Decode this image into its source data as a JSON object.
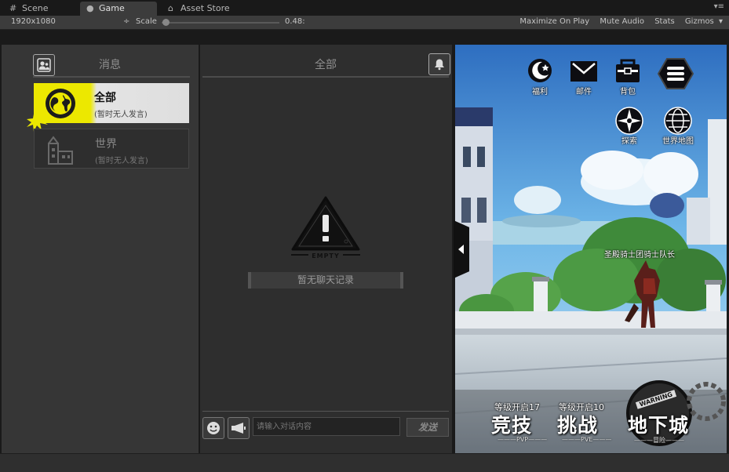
{
  "tabs": {
    "scene": "Scene",
    "game": "Game",
    "asset_store": "Asset Store",
    "menu": "▾≡"
  },
  "toolbar": {
    "resolution": "1920x1080",
    "resolution_arrow": "÷",
    "scale_label": "Scale",
    "scale_value": "0.48:",
    "maximize": "Maximize On Play",
    "mute": "Mute Audio",
    "stats": "Stats",
    "gizmos": "Gizmos",
    "gizmos_arrow": "▾"
  },
  "left_panel": {
    "title": "消息",
    "channels": [
      {
        "name": "全部",
        "subtitle": "(暂时无人发言)",
        "selected": true
      },
      {
        "name": "世界",
        "subtitle": "(暂时无人发言)",
        "selected": false
      }
    ]
  },
  "chat": {
    "title": "全部",
    "empty_label": "EMPTY",
    "empty_text": "暂无聊天记录",
    "input_placeholder": "请输入对话内容",
    "send_label": "发送"
  },
  "game_hud": {
    "top_buttons": [
      {
        "label": "福利",
        "icon": "moon-star-icon"
      },
      {
        "label": "邮件",
        "icon": "mail-icon"
      },
      {
        "label": "背包",
        "icon": "backpack-icon"
      },
      {
        "label": "",
        "icon": "menu-icon"
      }
    ],
    "side_buttons": [
      {
        "label": "探索",
        "icon": "compass-icon"
      },
      {
        "label": "世界地图",
        "icon": "globe-icon"
      }
    ],
    "npc_name": "圣殿骑士团骑士队长",
    "modes": [
      {
        "level": "等级开启17",
        "title": "竞技",
        "tag": "———PVP———"
      },
      {
        "level": "等级开启10",
        "title": "挑战",
        "tag": "———PVE———"
      },
      {
        "level": "",
        "title": "地下城",
        "tag": "———冒险———"
      }
    ],
    "warning_text": "WARNING"
  },
  "colors": {
    "accent_yellow": "#ece800",
    "panel": "#363636",
    "panel_dark": "#2e2e2e"
  }
}
